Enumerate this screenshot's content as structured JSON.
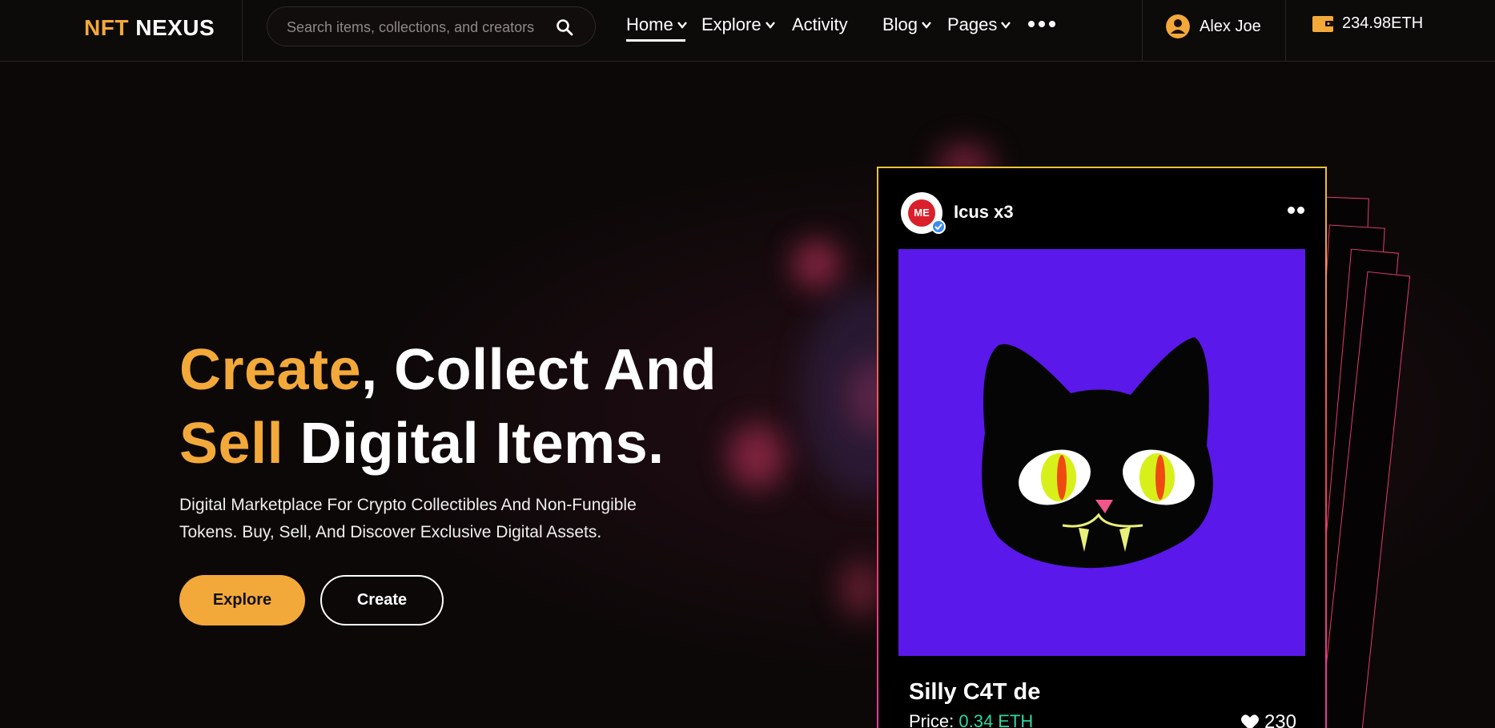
{
  "header": {
    "logo_part1": "NFT",
    "logo_part2": "NEXUS",
    "search_placeholder": "Search items, collections, and creators",
    "nav": {
      "home": "Home",
      "explore": "Explore",
      "activity": "Activity",
      "blog": "Blog",
      "pages": "Pages"
    },
    "user_name": "Alex Joe",
    "wallet_balance": "234.98ETH"
  },
  "hero": {
    "title_accent1": "Create",
    "title_rest1": ", Collect And",
    "title_accent2": "Sell",
    "title_rest2": " Digital Items.",
    "subtitle_line1": "Digital Marketplace For Crypto Collectibles And Non-Fungible",
    "subtitle_line2": "Tokens. Buy, Sell, And Discover Exclusive Digital Assets.",
    "explore_button": "Explore",
    "create_button": "Create"
  },
  "card": {
    "creator_name": "Icus x3",
    "creator_logo_text": "ME",
    "item_name": "Silly C4T de",
    "price_label": "Price:",
    "price_value": "0.34 ETH",
    "likes": "230"
  },
  "colors": {
    "accent": "#f3a93a",
    "card_image_bg": "#5b18ea",
    "price_green": "#2fd6a0"
  }
}
